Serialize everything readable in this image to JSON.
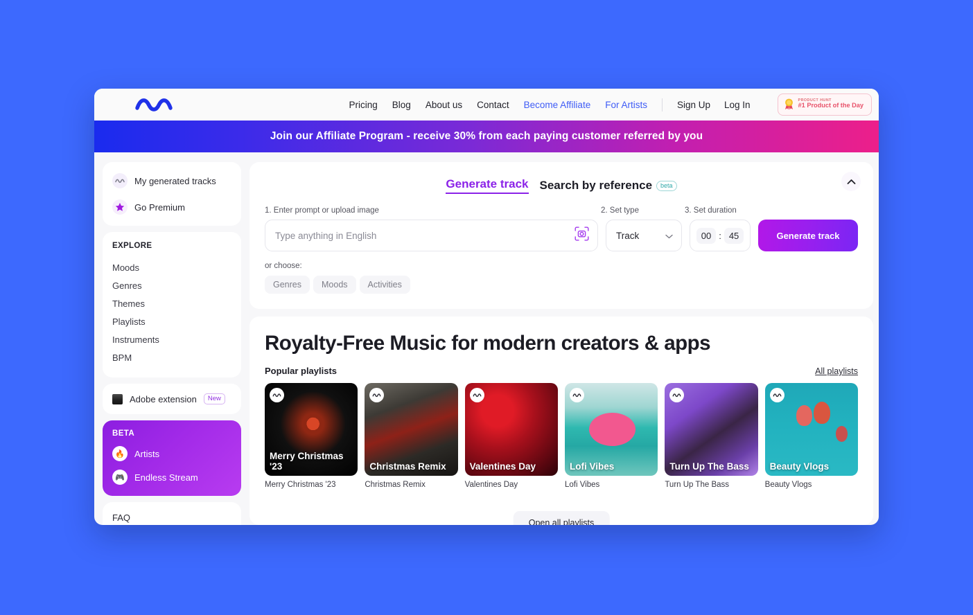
{
  "nav": {
    "logo_icon": "wave-logo-icon",
    "links": [
      {
        "label": "Pricing",
        "accent": false
      },
      {
        "label": "Blog",
        "accent": false
      },
      {
        "label": "About us",
        "accent": false
      },
      {
        "label": "Contact",
        "accent": false
      },
      {
        "label": "Become Affiliate",
        "accent": true
      },
      {
        "label": "For Artists",
        "accent": true
      }
    ],
    "sign_up": "Sign Up",
    "log_in": "Log In",
    "product_hunt": {
      "icon": "medal-icon",
      "top_label": "PRODUCT HUNT",
      "main_label": "#1 Product of the Day"
    }
  },
  "banner": {
    "text": "Join our Affiliate Program - receive 30% from each paying customer referred by you",
    "gradient_from": "#1a2bee",
    "gradient_to": "#ec1f8a"
  },
  "sidebar": {
    "top_items": [
      {
        "label": "My generated tracks",
        "icon": "wave-icon"
      },
      {
        "label": "Go Premium",
        "icon": "star-icon"
      }
    ],
    "explore_heading": "EXPLORE",
    "explore_items": [
      {
        "label": "Moods"
      },
      {
        "label": "Genres"
      },
      {
        "label": "Themes"
      },
      {
        "label": "Playlists"
      },
      {
        "label": "Instruments"
      },
      {
        "label": "BPM"
      }
    ],
    "adobe": {
      "label": "Adobe extension",
      "tag": "New",
      "icon": "adobe-icon"
    },
    "beta": {
      "heading": "BETA",
      "items": [
        {
          "label": "Artists",
          "icon": "fire-icon",
          "glyph": "🔥"
        },
        {
          "label": "Endless Stream",
          "icon": "gamepad-icon",
          "glyph": "🎮"
        }
      ]
    },
    "faq": "FAQ"
  },
  "generator": {
    "tabs": [
      {
        "label": "Generate track",
        "active": true
      },
      {
        "label": "Search by reference",
        "active": false
      }
    ],
    "beta_pill": "beta",
    "collapse_icon": "chevron-up-icon",
    "labels": {
      "step1": "1. Enter prompt or upload image",
      "step2": "2. Set type",
      "step3": "3. Set duration"
    },
    "prompt": {
      "value": "",
      "placeholder": "Type anything in English",
      "icon": "image-scan-icon"
    },
    "type_select": {
      "value": "Track",
      "icon": "chevron-down-icon"
    },
    "duration": {
      "minutes": "00",
      "separator": ":",
      "seconds": "45"
    },
    "generate_button": "Generate track",
    "or_choose": "or choose:",
    "chips": [
      {
        "label": "Genres"
      },
      {
        "label": "Moods"
      },
      {
        "label": "Activities"
      }
    ]
  },
  "playlists": {
    "headline": "Royalty-Free Music for modern creators & apps",
    "sub_title": "Popular playlists",
    "all_link": "All playlists",
    "open_all": "Open all playlists",
    "items": [
      {
        "title": "Merry Christmas '23",
        "caption": "Merry Christmas '23",
        "art": "poinsettia-on-black"
      },
      {
        "title": "Christmas Remix",
        "caption": "Christmas Remix",
        "art": "santa-boots-tree"
      },
      {
        "title": "Valentines Day",
        "caption": "Valentines Day",
        "art": "red-roses"
      },
      {
        "title": "Lofi Vibes",
        "caption": "Lofi Vibes",
        "art": "flamingo-float-sea"
      },
      {
        "title": "Turn Up The Bass",
        "caption": "Turn Up The Bass",
        "art": "guitarist-purple-stage"
      },
      {
        "title": "Beauty Vlogs",
        "caption": "Beauty Vlogs",
        "art": "hot-air-balloons-sky"
      }
    ]
  },
  "theme": {
    "page_background": "#3d69fe",
    "accent_purple": "#8b22e8",
    "accent_blue": "#3f5cf6"
  }
}
